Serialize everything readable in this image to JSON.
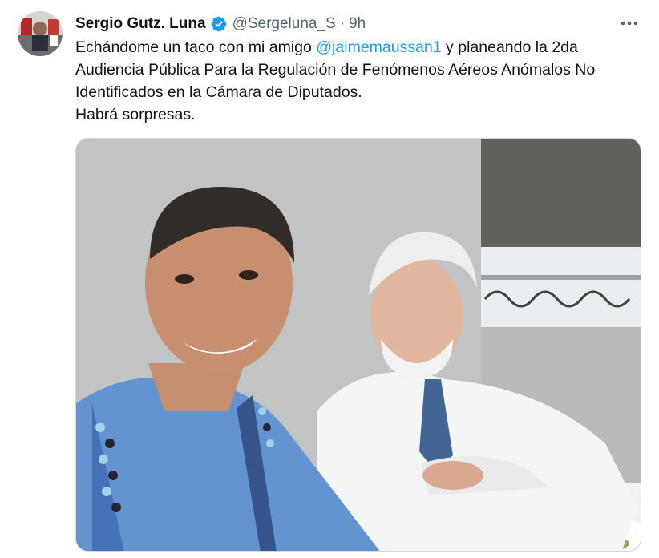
{
  "tweet": {
    "author": {
      "display_name": "Sergio Gutz. Luna",
      "handle": "@Sergeluna_S",
      "verified": true,
      "verified_icon": "verified-badge-icon",
      "avatar_icon": "avatar"
    },
    "separator": "·",
    "time": "9h",
    "more_icon": "more-options-icon",
    "text": {
      "line1_before": "Echándome un taco con mi amigo ",
      "mention": "@jaimemaussan1",
      "line1_after": " y planeando la 2da",
      "line2": "Audiencia Pública Para la Regulación de Fenómenos Aéreos Anómalos No",
      "line3": "Identificados en la Cámara de Diputados.",
      "line4": "Habrá sorpresas."
    },
    "media": {
      "kind": "photo"
    }
  },
  "colors": {
    "text": "#0f1419",
    "secondary": "#536471",
    "link": "#1d9bf0",
    "verified": "#1d9bf0",
    "border": "#cfd9de"
  }
}
